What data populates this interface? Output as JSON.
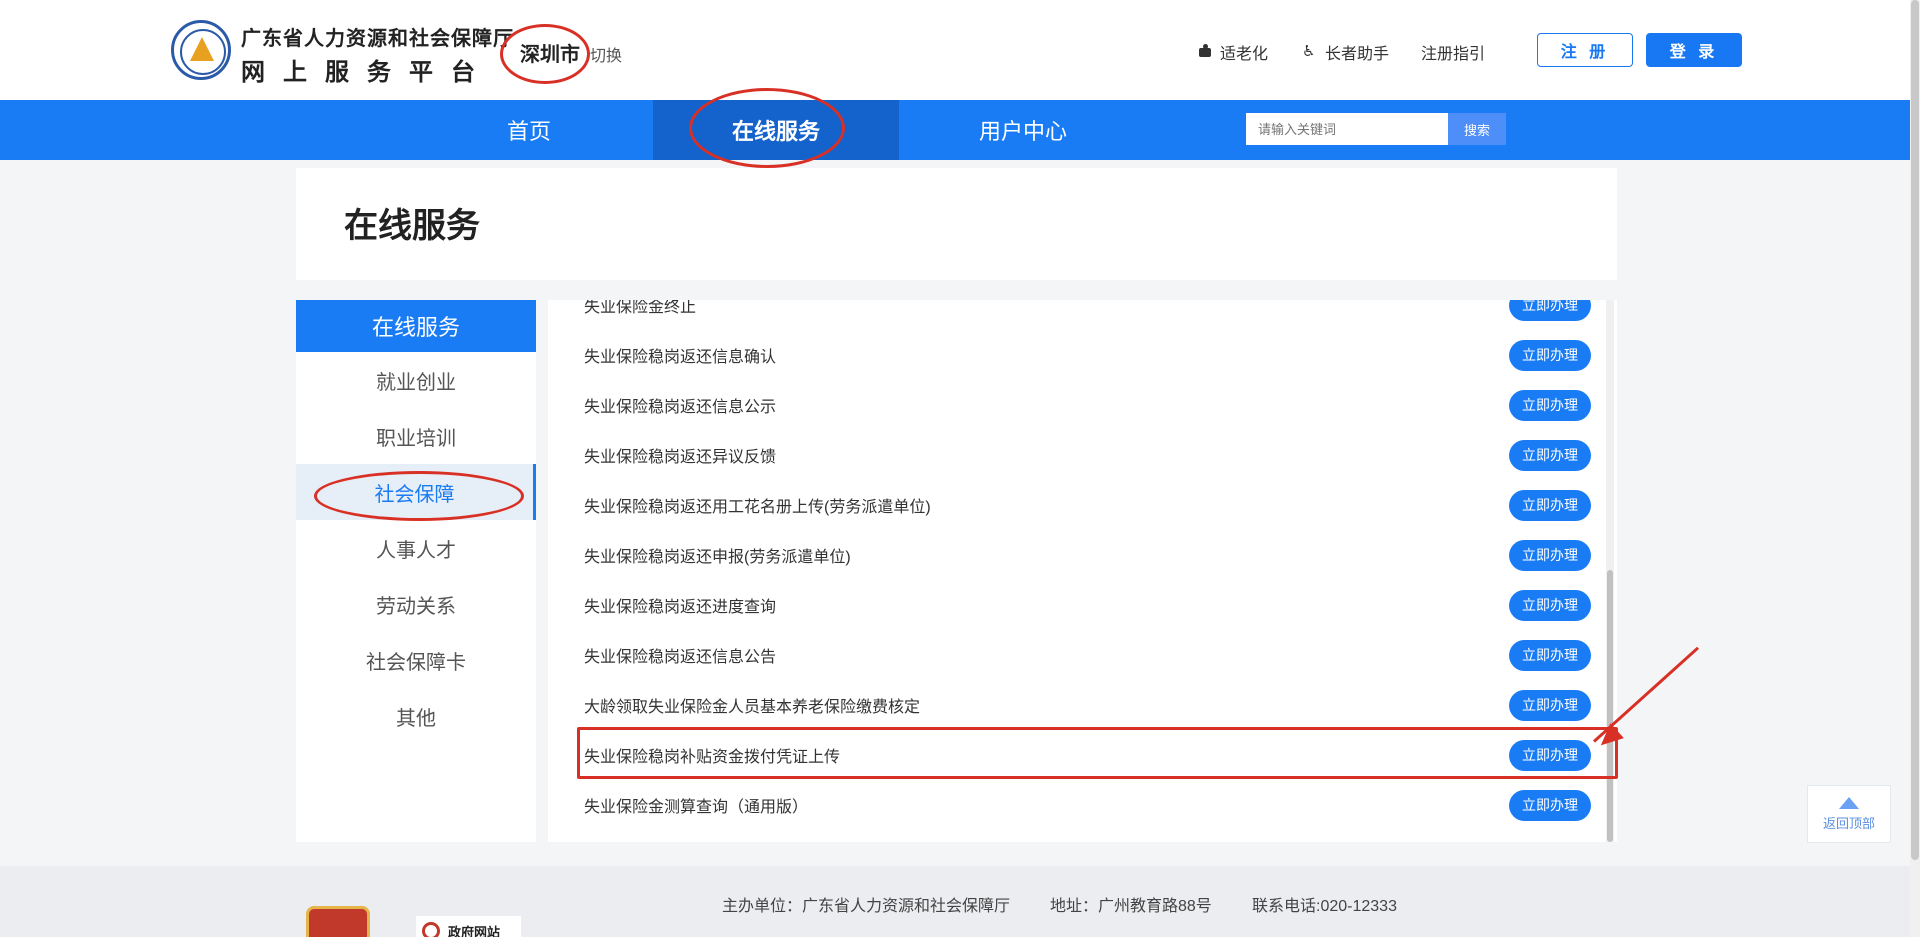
{
  "header": {
    "org_name": "广东省人力资源和社会保障厅",
    "platform_name": "网上服务平台",
    "city": "深圳市",
    "city_switch": "切换",
    "links": [
      "适老化",
      "长者助手",
      "注册指引"
    ],
    "register_label": "注 册",
    "login_label": "登 录"
  },
  "nav": {
    "items": [
      "首页",
      "在线服务",
      "用户中心"
    ],
    "active": "在线服务",
    "search_placeholder": "请输入关键词",
    "search_button": "搜索"
  },
  "page": {
    "title": "在线服务"
  },
  "sidebar": {
    "heading": "在线服务",
    "items": [
      "就业创业",
      "职业培训",
      "社会保障",
      "人事人才",
      "劳动关系",
      "社会保障卡",
      "其他"
    ],
    "active": "社会保障"
  },
  "services": {
    "action_label": "立即办理",
    "items": [
      "失业保险金终止",
      "失业保险稳岗返还信息确认",
      "失业保险稳岗返还信息公示",
      "失业保险稳岗返还异议反馈",
      "失业保险稳岗返还用工花名册上传(劳务派遣单位)",
      "失业保险稳岗返还申报(劳务派遣单位)",
      "失业保险稳岗返还进度查询",
      "失业保险稳岗返还信息公告",
      "大龄领取失业保险金人员基本养老保险缴费核定",
      "失业保险稳岗补贴资金拨付凭证上传",
      "失业保险金测算查询（通用版）"
    ],
    "highlighted": "失业保险稳岗补贴资金拨付凭证上传"
  },
  "back_to_top": "返回顶部",
  "footer": {
    "sponsor": "主办单位：广东省人力资源和社会保障厅",
    "address": "地址：广州教育路88号",
    "phone": "联系电话:020-12333",
    "gov_badge": "政府网站"
  },
  "colors": {
    "primary": "#1a7cf5",
    "annotation": "#d93025"
  }
}
